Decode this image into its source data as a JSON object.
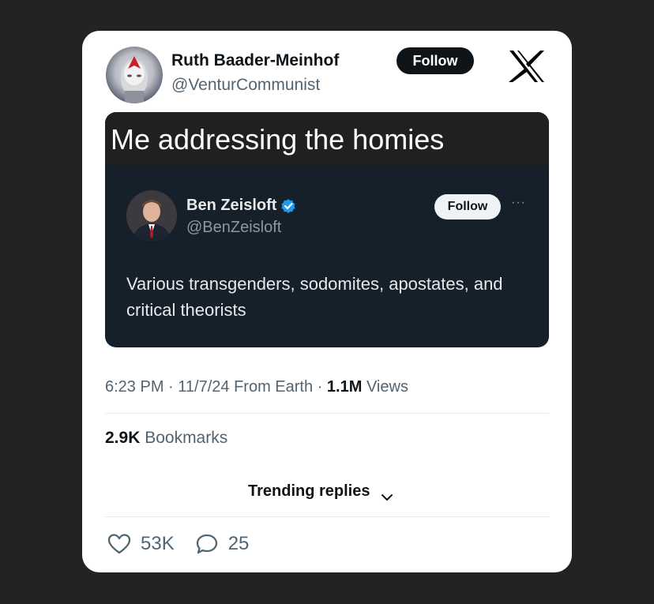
{
  "author": {
    "name": "Ruth Baader-Meinhof",
    "handle": "@VenturCommunist",
    "follow_label": "Follow"
  },
  "media": {
    "caption": "Me addressing the homies",
    "quoted_post": {
      "name": "Ben Zeisloft",
      "handle": "@BenZeisloft",
      "follow_label": "Follow",
      "more_label": "···",
      "text": "Various transgenders, sodomites, apostates, and critical theorists",
      "verified": true
    }
  },
  "meta": {
    "time": "6:23 PM",
    "sep1": "·",
    "date": "11/7/24",
    "location": "From Earth",
    "sep2": "·",
    "views_count": "1.1M",
    "views_label": "Views"
  },
  "bookmarks": {
    "count": "2.9K",
    "label": "Bookmarks"
  },
  "trending": {
    "label": "Trending replies"
  },
  "actions": {
    "likes": "53K",
    "replies": "25"
  },
  "colors": {
    "background": "#232323",
    "card": "#ffffff",
    "text_primary": "#0f1419",
    "text_secondary": "#536471",
    "verified": "#1d9bf0",
    "media_bg": "#15202b"
  },
  "icons": [
    "x-logo-icon",
    "verified-badge-icon",
    "chevron-down-icon",
    "heart-icon",
    "reply-icon",
    "more-icon"
  ]
}
